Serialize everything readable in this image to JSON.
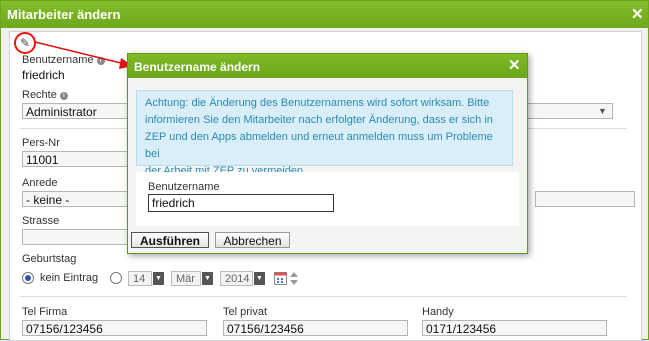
{
  "window": {
    "title": "Mitarbeiter ändern",
    "close": "✕"
  },
  "form": {
    "username_label": "Benutzername",
    "username_value": "friedrich",
    "rights_label": "Rechte",
    "rights_value": "Administrator",
    "persnr_label": "Pers-Nr",
    "persnr_value": "11001",
    "anrede_label": "Anrede",
    "anrede_value": "- keine -",
    "strasse_label": "Strasse",
    "geburtstag_label": "Geburtstag",
    "kein_eintrag": "kein Eintrag",
    "birthday": {
      "day": "14",
      "month": "Mär",
      "year": "2014"
    },
    "tel_firma_label": "Tel Firma",
    "tel_firma_value": "07156/123456",
    "tel_privat_label": "Tel privat",
    "tel_privat_value": "07156/123456",
    "handy_label": "Handy",
    "handy_value": "0171/123456"
  },
  "dialog": {
    "title": "Benutzername ändern",
    "close": "✕",
    "notice_lines": [
      "Achtung: die Änderung des Benutzernamens wird sofort wirksam. Bitte",
      "informieren Sie den Mitarbeiter nach erfolgter Änderung, dass er sich in",
      "ZEP und den Apps abmelden und erneut anmelden muss um Probleme bei",
      "der Arbeit mit ZEP zu vermeiden."
    ],
    "field_label": "Benutzername",
    "field_value": "friedrich",
    "execute_button": "Ausführen",
    "cancel_button": "Abbrechen"
  },
  "colors": {
    "accent": "#75ad22",
    "notice_text": "#2a8cb2",
    "annotation": "#e11111"
  },
  "icons": {
    "edit": "pencil-icon",
    "info": "info-icon",
    "calendar": "calendar-icon"
  }
}
